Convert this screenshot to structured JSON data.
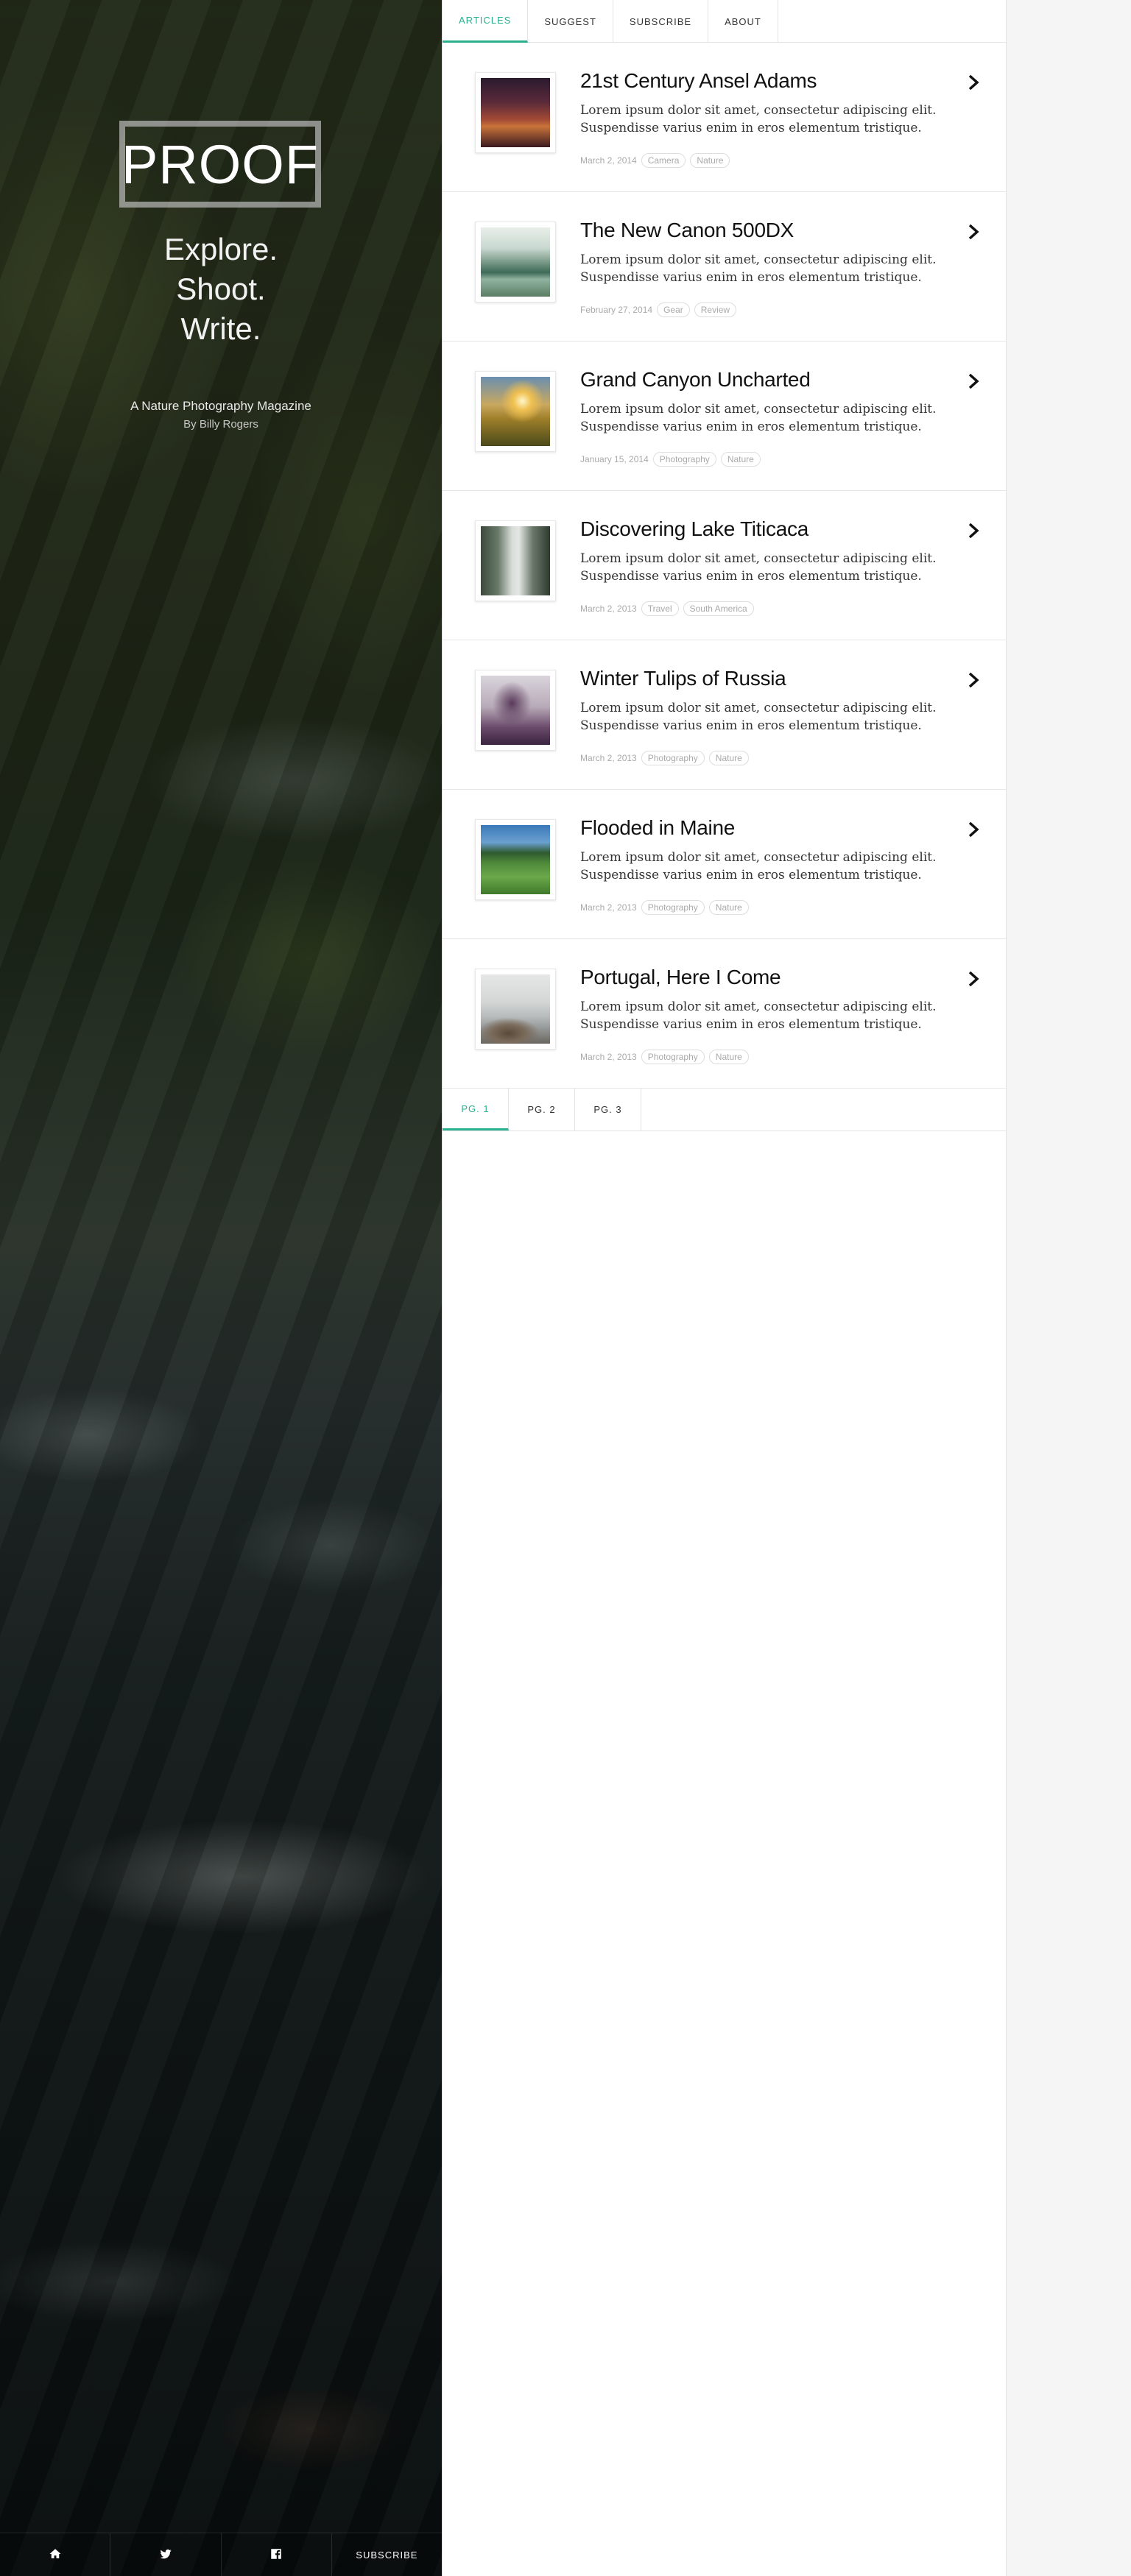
{
  "hero": {
    "logo": "PROOF",
    "tagline": [
      "Explore.",
      "Shoot.",
      "Write."
    ],
    "subtitle": "A Nature Photography Magazine",
    "byline": "By Billy Rogers",
    "footer": {
      "home_icon": "home-icon",
      "twitter_icon": "twitter-icon",
      "facebook_icon": "facebook-icon",
      "subscribe_label": "SUBSCRIBE"
    }
  },
  "nav": {
    "tabs": [
      {
        "label": "ARTICLES",
        "active": true
      },
      {
        "label": "SUGGEST",
        "active": false
      },
      {
        "label": "SUBSCRIBE",
        "active": false
      },
      {
        "label": "ABOUT",
        "active": false
      }
    ]
  },
  "articles": [
    {
      "title": "21st Century Ansel Adams",
      "excerpt": "Lorem ipsum dolor sit amet, consectetur adipiscing elit. Suspendisse varius enim in eros elementum tristique.",
      "date": "March 2, 2014",
      "tags": [
        "Camera",
        "Nature"
      ]
    },
    {
      "title": "The New Canon 500DX",
      "excerpt": "Lorem ipsum dolor sit amet, consectetur adipiscing elit. Suspendisse varius enim in eros elementum tristique.",
      "date": "February 27, 2014",
      "tags": [
        "Gear",
        "Review"
      ]
    },
    {
      "title": "Grand Canyon Uncharted",
      "excerpt": "Lorem ipsum dolor sit amet, consectetur adipiscing elit. Suspendisse varius enim in eros elementum tristique.",
      "date": "January 15, 2014",
      "tags": [
        "Photography",
        "Nature"
      ]
    },
    {
      "title": "Discovering Lake Titicaca",
      "excerpt": "Lorem ipsum dolor sit amet, consectetur adipiscing elit. Suspendisse varius enim in eros elementum tristique.",
      "date": "March 2, 2013",
      "tags": [
        "Travel",
        "South America"
      ]
    },
    {
      "title": "Winter Tulips of Russia",
      "excerpt": "Lorem ipsum dolor sit amet, consectetur adipiscing elit. Suspendisse varius enim in eros elementum tristique.",
      "date": "March 2, 2013",
      "tags": [
        "Photography",
        "Nature"
      ]
    },
    {
      "title": "Flooded in Maine",
      "excerpt": "Lorem ipsum dolor sit amet, consectetur adipiscing elit. Suspendisse varius enim in eros elementum tristique.",
      "date": "March 2, 2013",
      "tags": [
        "Photography",
        "Nature"
      ]
    },
    {
      "title": "Portugal, Here I Come",
      "excerpt": "Lorem ipsum dolor sit amet, consectetur adipiscing elit. Suspendisse varius enim in eros elementum tristique.",
      "date": "March 2, 2013",
      "tags": [
        "Photography",
        "Nature"
      ]
    }
  ],
  "pager": {
    "pages": [
      {
        "label": "PG. 1",
        "active": true
      },
      {
        "label": "PG. 2",
        "active": false
      },
      {
        "label": "PG. 3",
        "active": false
      }
    ]
  },
  "colors": {
    "accent": "#2bb08f",
    "text": "#111111",
    "muted": "#aaaaaa"
  }
}
